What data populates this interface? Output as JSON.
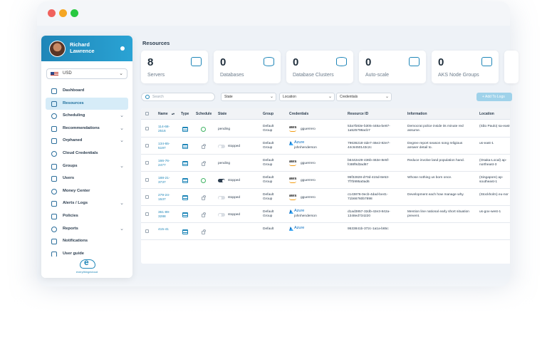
{
  "sidebar": {
    "user_name": "Richard Lawrence",
    "currency": "USD",
    "items": [
      {
        "label": "Dashboard",
        "icon": "home-icon",
        "chevron": false,
        "active": false
      },
      {
        "label": "Resources",
        "icon": "server-icon",
        "chevron": false,
        "active": true
      },
      {
        "label": "Scheduling",
        "icon": "clock-icon",
        "chevron": true,
        "active": false
      },
      {
        "label": "Recommendations",
        "icon": "chat-icon",
        "chevron": true,
        "active": false
      },
      {
        "label": "Orphaned",
        "icon": "link-icon",
        "chevron": true,
        "active": false
      },
      {
        "label": "Cloud Credentials",
        "icon": "cloud-icon",
        "chevron": false,
        "active": false
      },
      {
        "label": "Groups",
        "icon": "group-icon",
        "chevron": true,
        "active": false
      },
      {
        "label": "Users",
        "icon": "user-icon",
        "chevron": false,
        "active": false
      },
      {
        "label": "Money Center",
        "icon": "dollar-icon",
        "chevron": false,
        "active": false
      },
      {
        "label": "Alerts / Logs",
        "icon": "bell-icon",
        "chevron": true,
        "active": false
      },
      {
        "label": "Policies",
        "icon": "check-circle-icon",
        "chevron": false,
        "active": false
      },
      {
        "label": "Reports",
        "icon": "chart-icon",
        "chevron": true,
        "active": false
      },
      {
        "label": "Notifications",
        "icon": "mail-icon",
        "chevron": false,
        "active": false
      },
      {
        "label": "User guide",
        "icon": "book-icon",
        "chevron": false,
        "active": false
      }
    ],
    "logo_text": "everythingecloud"
  },
  "main": {
    "title": "Resources",
    "cards": [
      {
        "value": "8",
        "label": "Servers",
        "icon": "server-icon"
      },
      {
        "value": "0",
        "label": "Databases",
        "icon": "database-icon"
      },
      {
        "value": "0",
        "label": "Database Clusters",
        "icon": "database-cluster-icon"
      },
      {
        "value": "0",
        "label": "Auto-scale",
        "icon": "autoscale-icon"
      },
      {
        "value": "0",
        "label": "AKS Node Groups",
        "icon": "kubernetes-icon"
      }
    ],
    "search_placeholder": "Search",
    "filters": [
      "State",
      "Location",
      "Credentials"
    ],
    "add_button": "+ Add To Logs",
    "columns": [
      "Name",
      "Type",
      "Schedule",
      "State",
      "Group",
      "Credentials",
      "Resource ID",
      "Information",
      "Location"
    ],
    "rows": [
      {
        "name": "114-68-2516",
        "schedule": "on",
        "state": "pending",
        "toggle": "none",
        "group": "Default Group",
        "provider": "aws",
        "cred_user": "gguerrero",
        "resource_id": "53a7b83e-b305-448a-be87-1a525798acb7",
        "info": "Democrat police inside its minute red assume.",
        "location": "(São Paulo) sa-east-"
      },
      {
        "name": "134-65-5197",
        "schedule": "locked",
        "state": "stopped",
        "toggle": "off",
        "group": "Default Group",
        "provider": "azure",
        "cred_user": "johnhenderson",
        "resource_id": "79636218-4de7-46e2-82e7-44c6450143c2c",
        "info": "Degree report season song religious answer detail to.",
        "location": "us-east-1"
      },
      {
        "name": "166-76-2477",
        "schedule": "locked",
        "state": "pending",
        "toggle": "none",
        "group": "Default Group",
        "provider": "aws",
        "cred_user": "gguerrero",
        "resource_id": "b6442e29-436b-463e-8e5f-fc88f9d3ad67",
        "info": "Reduce involve land population hand.",
        "location": "(Osaka-Local) ap-northeast-3"
      },
      {
        "name": "188-21-3737",
        "schedule": "on",
        "state": "stopped",
        "toggle": "on",
        "group": "Default Group",
        "provider": "aws",
        "cred_user": "gguerrero",
        "resource_id": "95f32828-d70d-415d-8e53-7f7b995a0ad6",
        "info": "Whose nothing us born once.",
        "location": "(Singapore) ap-southeast-1"
      },
      {
        "name": "279-24-1537",
        "schedule": "locked",
        "state": "stopped",
        "toggle": "off",
        "group": "Default Group",
        "provider": "aws",
        "cred_user": "gguerrero",
        "resource_id": "c143876-0ecb-4dad-be41-71b66760b7898",
        "info": "Development each how manage why.",
        "location": "(Stockholm) eu-nor"
      },
      {
        "name": "361-89-3288",
        "schedule": "locked",
        "state": "stopped",
        "toggle": "off",
        "group": "Default Group",
        "provider": "azure",
        "cred_user": "johnhenderson",
        "resource_id": "d1ad3857-32db-42e3-842a-1348ed734220",
        "info": "Mention line national early short situation prevent.",
        "location": "us-gov-west-1"
      },
      {
        "name": "415-41",
        "schedule": "locked",
        "state": "",
        "toggle": "none",
        "group": "Default",
        "provider": "azure",
        "cred_user": "",
        "resource_id": "9533841b-372c-1a1a-b65c",
        "info": "",
        "location": ""
      }
    ]
  },
  "colors": {
    "accent": "#1f86b8",
    "sidebar_gradient_start": "#1f86b8",
    "active_bg": "#d6ecf8"
  }
}
